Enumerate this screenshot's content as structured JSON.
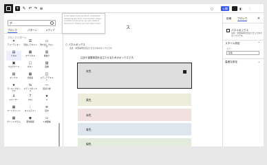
{
  "topbar": {
    "add_label": "+",
    "undo": "↶",
    "redo": "↷",
    "publish_label": "公開"
  },
  "inserter": {
    "search_value": "ポ",
    "tabs": [
      "ブロック",
      "パターン",
      "メディア"
    ],
    "section_heading": "ブロックパターン",
    "blocks": [
      {
        "label": "アコーディオン",
        "icon": "✦"
      },
      {
        "label": "見出しテキスト",
        "icon": "☰"
      },
      {
        "label": "吹き出しブロック",
        "icon": "▭"
      },
      {
        "label": "パネル",
        "icon": "▤",
        "selected": true
      },
      {
        "label": "タブパネル",
        "icon": "▦"
      },
      {
        "label": "横並び",
        "icon": "▥"
      },
      {
        "label": "ブログカード",
        "icon": "▣"
      },
      {
        "label": "ボタン",
        "icon": "▢"
      },
      {
        "label": "画像",
        "icon": "▨"
      },
      {
        "label": "ボックス",
        "icon": "▧"
      },
      {
        "label": "比較表",
        "icon": "▦"
      },
      {
        "label": "メディアテキスト",
        "icon": "◫"
      },
      {
        "label": "ランキングボックス",
        "icon": "★"
      },
      {
        "label": "ステップボックス",
        "icon": "⇆"
      },
      {
        "label": "区切り線",
        "icon": "―"
      },
      {
        "label": "スペーサー",
        "icon": "↕"
      },
      {
        "label": "FAQ",
        "icon": "?"
      },
      {
        "label": "★",
        "icon": "★"
      },
      {
        "label": "カードグリッド",
        "icon": "▦"
      },
      {
        "label": "タイムライン",
        "icon": "⋮"
      },
      {
        "label": "目次",
        "icon": "≡"
      },
      {
        "label": "グリッドカラム",
        "icon": "▦"
      },
      {
        "label": "著者情報",
        "icon": "◉"
      },
      {
        "label": "1.地図帳",
        "icon": "▭"
      }
    ]
  },
  "tooltip": {
    "text": "Lorem ipsum dolor sit amet, consectetur adipiscing elit. Proin ut fermentum neque. Curabitur euismod mi nec sem dapibus fermentum. Nullam at lorem ipsum dolor."
  },
  "canvas": {
    "title": "ス",
    "block_label": "パネルボックス",
    "block_desc": "注目・重要事項を目立たせるためのボックスです。",
    "description": "注目や重要事項を目立たせるためのボックスです。",
    "panels": [
      "灰色",
      "黄色",
      "赤色",
      "青色",
      "緑色"
    ]
  },
  "sidebar": {
    "tabs": [
      "投稿",
      "ブロック"
    ],
    "close": "×",
    "block_name": "パネルボックス",
    "block_desc": "注目・重要事項を目立たせるためのボックスです。",
    "section1": "スタイル設定",
    "select_label": "カラー",
    "select_value": "灰色",
    "section2": "高度な設定"
  }
}
